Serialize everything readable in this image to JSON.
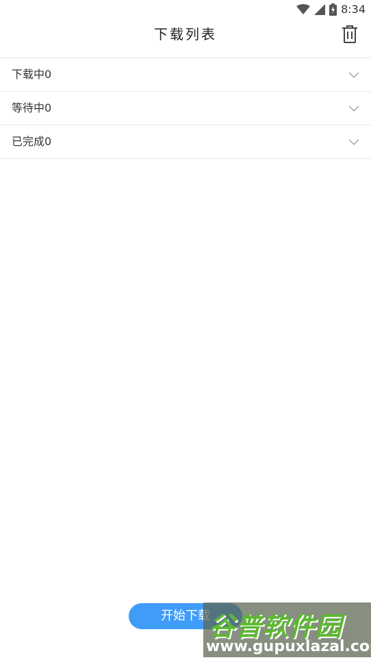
{
  "status_bar": {
    "time": "8:34",
    "icons": [
      "wifi-icon",
      "cell-signal-icon",
      "battery-charging-icon"
    ]
  },
  "header": {
    "title": "下载列表",
    "trash_icon": "trash-icon"
  },
  "sections": [
    {
      "label": "下载中0",
      "icon": "chevron-down-icon"
    },
    {
      "label": "等待中0",
      "icon": "chevron-down-icon"
    },
    {
      "label": "已完成0",
      "icon": "chevron-down-icon"
    }
  ],
  "start_button": {
    "label": "开始下载",
    "color": "#3f9cf8"
  },
  "watermark": {
    "brand": "谷普软件园",
    "url": "www.gupuxlazal.com"
  }
}
